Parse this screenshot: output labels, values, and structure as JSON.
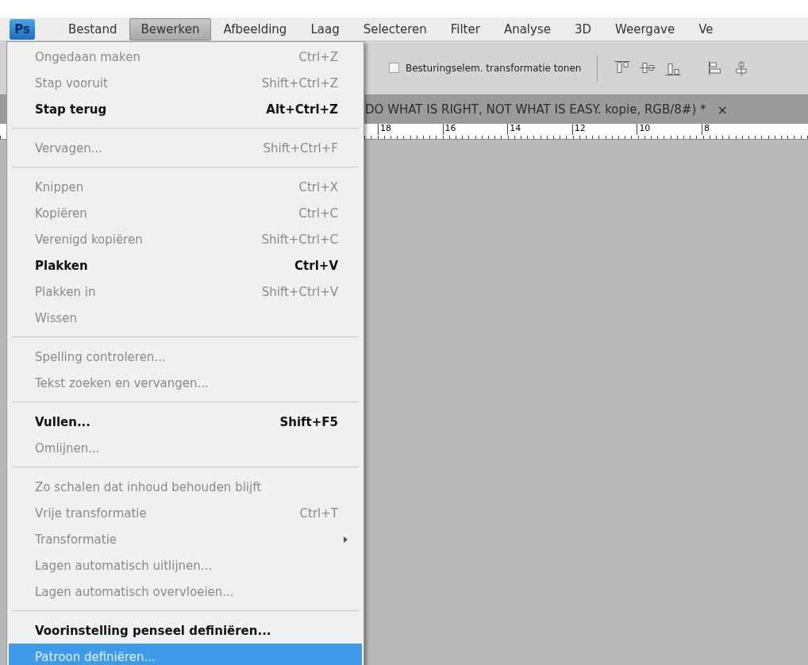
{
  "menu_bar": {
    "logo": "Ps",
    "items": [
      {
        "label": "Bestand",
        "selected": false
      },
      {
        "label": "Bewerken",
        "selected": true
      },
      {
        "label": "Afbeelding",
        "selected": false
      },
      {
        "label": "Laag",
        "selected": false
      },
      {
        "label": "Selecteren",
        "selected": false
      },
      {
        "label": "Filter",
        "selected": false
      },
      {
        "label": "Analyse",
        "selected": false
      },
      {
        "label": "3D",
        "selected": false
      },
      {
        "label": "Weergave",
        "selected": false
      },
      {
        "label": "Ve",
        "selected": false
      }
    ]
  },
  "edit_menu": {
    "items": [
      {
        "kind": "item",
        "label": "Ongedaan maken",
        "shortcut": "Ctrl+Z",
        "enabled": false,
        "selected": false,
        "submenu": false
      },
      {
        "kind": "item",
        "label": "Stap vooruit",
        "shortcut": "Shift+Ctrl+Z",
        "enabled": false,
        "selected": false,
        "submenu": false
      },
      {
        "kind": "item",
        "label": "Stap terug",
        "shortcut": "Alt+Ctrl+Z",
        "enabled": true,
        "selected": false,
        "submenu": false
      },
      {
        "kind": "separator"
      },
      {
        "kind": "item",
        "label": "Vervagen...",
        "shortcut": "Shift+Ctrl+F",
        "enabled": false,
        "selected": false,
        "submenu": false
      },
      {
        "kind": "separator"
      },
      {
        "kind": "item",
        "label": "Knippen",
        "shortcut": "Ctrl+X",
        "enabled": false,
        "selected": false,
        "submenu": false
      },
      {
        "kind": "item",
        "label": "Kopiëren",
        "shortcut": "Ctrl+C",
        "enabled": false,
        "selected": false,
        "submenu": false
      },
      {
        "kind": "item",
        "label": "Verenigd kopiëren",
        "shortcut": "Shift+Ctrl+C",
        "enabled": false,
        "selected": false,
        "submenu": false
      },
      {
        "kind": "item",
        "label": "Plakken",
        "shortcut": "Ctrl+V",
        "enabled": true,
        "selected": false,
        "submenu": false
      },
      {
        "kind": "item",
        "label": "Plakken in",
        "shortcut": "Shift+Ctrl+V",
        "enabled": false,
        "selected": false,
        "submenu": false
      },
      {
        "kind": "item",
        "label": "Wissen",
        "enabled": false,
        "selected": false,
        "submenu": false
      },
      {
        "kind": "separator"
      },
      {
        "kind": "item",
        "label": "Spelling controleren...",
        "enabled": false,
        "selected": false,
        "submenu": false
      },
      {
        "kind": "item",
        "label": "Tekst zoeken en vervangen...",
        "enabled": false,
        "selected": false,
        "submenu": false
      },
      {
        "kind": "separator"
      },
      {
        "kind": "item",
        "label": "Vullen...",
        "shortcut": "Shift+F5",
        "enabled": true,
        "selected": false,
        "submenu": false
      },
      {
        "kind": "item",
        "label": "Omlijnen...",
        "enabled": false,
        "selected": false,
        "submenu": false
      },
      {
        "kind": "separator"
      },
      {
        "kind": "item",
        "label": "Zo schalen dat inhoud behouden blijft",
        "enabled": false,
        "selected": false,
        "submenu": false
      },
      {
        "kind": "item",
        "label": "Vrije transformatie",
        "shortcut": "Ctrl+T",
        "enabled": false,
        "selected": false,
        "submenu": false
      },
      {
        "kind": "item",
        "label": "Transformatie",
        "enabled": false,
        "selected": false,
        "submenu": true
      },
      {
        "kind": "item",
        "label": "Lagen automatisch uitlijnen...",
        "enabled": false,
        "selected": false,
        "submenu": false
      },
      {
        "kind": "item",
        "label": "Lagen automatisch overvloeien...",
        "enabled": false,
        "selected": false,
        "submenu": false
      },
      {
        "kind": "separator"
      },
      {
        "kind": "item",
        "label": "Voorinstelling penseel definiëren...",
        "enabled": true,
        "selected": false,
        "submenu": false
      },
      {
        "kind": "item",
        "label": "Patroon definiëren...",
        "enabled": false,
        "selected": true,
        "submenu": false
      }
    ]
  },
  "options_bar": {
    "checkbox": {
      "label": "Besturingselem. transformatie tonen",
      "checked": false
    }
  },
  "document_tab": {
    "title": "DO WHAT  IS RIGHT, NOT WHAT  IS EASY. kopie, RGB/8#) *",
    "close": "×"
  },
  "ruler": {
    "labels": [
      "18",
      "16",
      "14",
      "12",
      "10",
      "8"
    ]
  }
}
